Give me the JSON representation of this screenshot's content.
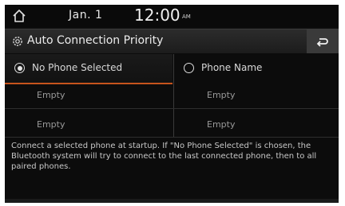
{
  "status": {
    "date": "Jan.  1",
    "time": "12:00",
    "ampm": "AM"
  },
  "header": {
    "title": "Auto Connection Priority"
  },
  "options": {
    "left_label": "No Phone Selected",
    "right_label": "Phone Name",
    "selected": "left"
  },
  "slots": [
    [
      "Empty",
      "Empty"
    ],
    [
      "Empty",
      "Empty"
    ]
  ],
  "description": "Connect a selected phone at startup. If \"No Phone Selected\" is chosen, the Bluetooth system will try to connect to the last connected phone, then to all paired phones.",
  "colors": {
    "accent": "#c7541d",
    "background": "#0c0c0c"
  }
}
